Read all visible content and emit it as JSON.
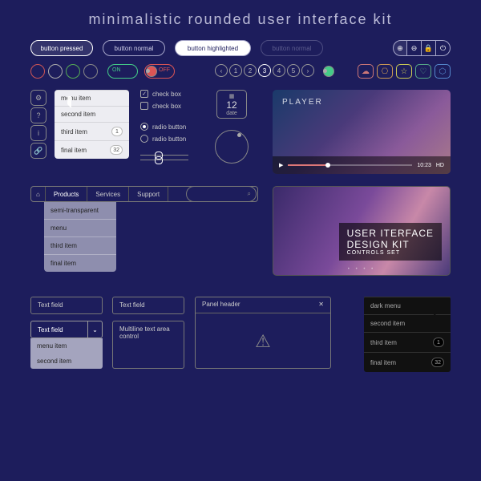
{
  "title": "minimalistic rounded user interface kit",
  "buttons": {
    "pressed": "button pressed",
    "normal1": "button normal",
    "highlighted": "button highlighted",
    "normal2": "button normal"
  },
  "toggles": {
    "on": "ON",
    "off": "OFF"
  },
  "pager": {
    "items": [
      "1",
      "2",
      "3",
      "4",
      "5"
    ],
    "selected": 2
  },
  "menu_light": {
    "items": [
      {
        "label": "menu item",
        "badge": null
      },
      {
        "label": "second item",
        "badge": null
      },
      {
        "label": "third item",
        "badge": "1"
      },
      {
        "label": "final item",
        "badge": "32"
      }
    ]
  },
  "checkboxes": [
    {
      "label": "check box",
      "checked": true
    },
    {
      "label": "check box",
      "checked": false
    }
  ],
  "radios": [
    {
      "label": "radio button",
      "selected": true
    },
    {
      "label": "radio button",
      "selected": false
    }
  ],
  "date": {
    "day": "12",
    "label": "date"
  },
  "player": {
    "label": "PLAYER",
    "time": "10:23",
    "quality": "HD"
  },
  "nav": {
    "items": [
      "Products",
      "Services",
      "Support"
    ],
    "selected": 0
  },
  "dropsemi": [
    "semi-transparent",
    "menu",
    "third item",
    "final item"
  ],
  "banner": {
    "line1": "USER ITERFACE",
    "line2": "DESIGN KIT",
    "line3": "CONTROLS SET"
  },
  "textfields": {
    "tf1": "Text field",
    "tf2": "Text field",
    "dropdown": "Text field",
    "multiline": "Multiline text area control"
  },
  "dropdown_items": [
    "menu item",
    "second item"
  ],
  "panel": {
    "header": "Panel header"
  },
  "dark_menu": {
    "items": [
      {
        "label": "dark menu",
        "badge": null
      },
      {
        "label": "second item",
        "badge": null
      },
      {
        "label": "third item",
        "badge": "1"
      },
      {
        "label": "final item",
        "badge": "32"
      }
    ]
  }
}
